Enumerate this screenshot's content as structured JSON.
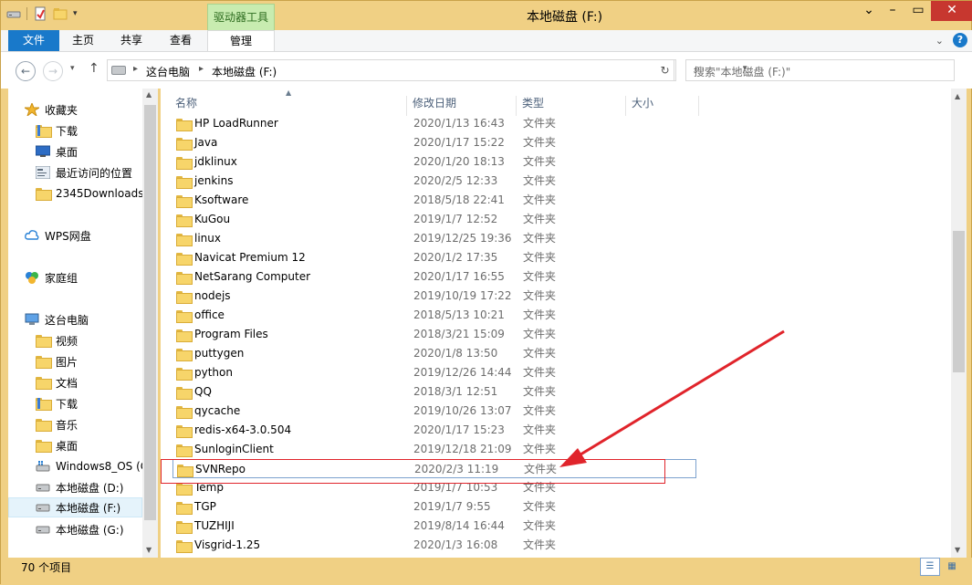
{
  "window": {
    "title": "本地磁盘 (F:)",
    "context_tab": "驱动器工具"
  },
  "ribbon": {
    "tabs": [
      "文件",
      "主页",
      "共享",
      "查看",
      "管理"
    ]
  },
  "address": {
    "crumbs": [
      "这台电脑",
      "本地磁盘 (F:)"
    ],
    "search_placeholder": "搜索\"本地磁盘 (F:)\""
  },
  "nav": {
    "items": [
      {
        "label": "收藏夹",
        "icon": "star-icon"
      },
      {
        "label": "下载",
        "icon": "folder-icon"
      },
      {
        "label": "桌面",
        "icon": "desktop-icon"
      },
      {
        "label": "最近访问的位置",
        "icon": "recent-icon"
      },
      {
        "label": "2345Downloads",
        "icon": "folder-icon"
      },
      {
        "label": "WPS网盘",
        "icon": "cloud-icon"
      },
      {
        "label": "家庭组",
        "icon": "homegroup-icon"
      },
      {
        "label": "这台电脑",
        "icon": "computer-icon"
      },
      {
        "label": "视频",
        "icon": "folder-icon"
      },
      {
        "label": "图片",
        "icon": "folder-icon"
      },
      {
        "label": "文档",
        "icon": "folder-icon"
      },
      {
        "label": "下载",
        "icon": "folder-icon"
      },
      {
        "label": "音乐",
        "icon": "folder-icon"
      },
      {
        "label": "桌面",
        "icon": "folder-icon"
      },
      {
        "label": "Windows8_OS (C",
        "icon": "os-drive-icon"
      },
      {
        "label": "本地磁盘 (D:)",
        "icon": "drive-icon"
      },
      {
        "label": "本地磁盘 (F:)",
        "icon": "drive-icon"
      },
      {
        "label": "本地磁盘 (G:)",
        "icon": "drive-icon"
      }
    ]
  },
  "columns": {
    "name": "名称",
    "date": "修改日期",
    "type": "类型",
    "size": "大小"
  },
  "files": [
    {
      "name": "HP LoadRunner",
      "date": "2020/1/13 16:43",
      "type": "文件夹"
    },
    {
      "name": "Java",
      "date": "2020/1/17 15:22",
      "type": "文件夹"
    },
    {
      "name": "jdklinux",
      "date": "2020/1/20 18:13",
      "type": "文件夹"
    },
    {
      "name": "jenkins",
      "date": "2020/2/5 12:33",
      "type": "文件夹"
    },
    {
      "name": "Ksoftware",
      "date": "2018/5/18 22:41",
      "type": "文件夹"
    },
    {
      "name": "KuGou",
      "date": "2019/1/7 12:52",
      "type": "文件夹"
    },
    {
      "name": "linux",
      "date": "2019/12/25 19:36",
      "type": "文件夹"
    },
    {
      "name": "Navicat Premium 12",
      "date": "2020/1/2 17:35",
      "type": "文件夹"
    },
    {
      "name": "NetSarang Computer",
      "date": "2020/1/17 16:55",
      "type": "文件夹"
    },
    {
      "name": "nodejs",
      "date": "2019/10/19 17:22",
      "type": "文件夹"
    },
    {
      "name": "office",
      "date": "2018/5/13 10:21",
      "type": "文件夹"
    },
    {
      "name": "Program Files",
      "date": "2018/3/21 15:09",
      "type": "文件夹"
    },
    {
      "name": "puttygen",
      "date": "2020/1/8 13:50",
      "type": "文件夹"
    },
    {
      "name": "python",
      "date": "2019/12/26 14:44",
      "type": "文件夹"
    },
    {
      "name": "QQ",
      "date": "2018/3/1 12:51",
      "type": "文件夹"
    },
    {
      "name": "qycache",
      "date": "2019/10/26 13:07",
      "type": "文件夹"
    },
    {
      "name": "redis-x64-3.0.504",
      "date": "2020/1/17 15:23",
      "type": "文件夹"
    },
    {
      "name": "SunloginClient",
      "date": "2019/12/18 21:09",
      "type": "文件夹"
    },
    {
      "name": "SVNRepo",
      "date": "2020/2/3 11:19",
      "type": "文件夹"
    },
    {
      "name": "Temp",
      "date": "2019/1/7 10:53",
      "type": "文件夹"
    },
    {
      "name": "TGP",
      "date": "2019/1/7 9:55",
      "type": "文件夹"
    },
    {
      "name": "TUZHIJI",
      "date": "2019/8/14 16:44",
      "type": "文件夹"
    },
    {
      "name": "Visgrid-1.25",
      "date": "2020/1/3 16:08",
      "type": "文件夹"
    }
  ],
  "status": {
    "count": "70 个项目"
  },
  "colors": {
    "accent": "#1979ca",
    "frame": "#f0d084",
    "annotation": "#e0242b"
  }
}
